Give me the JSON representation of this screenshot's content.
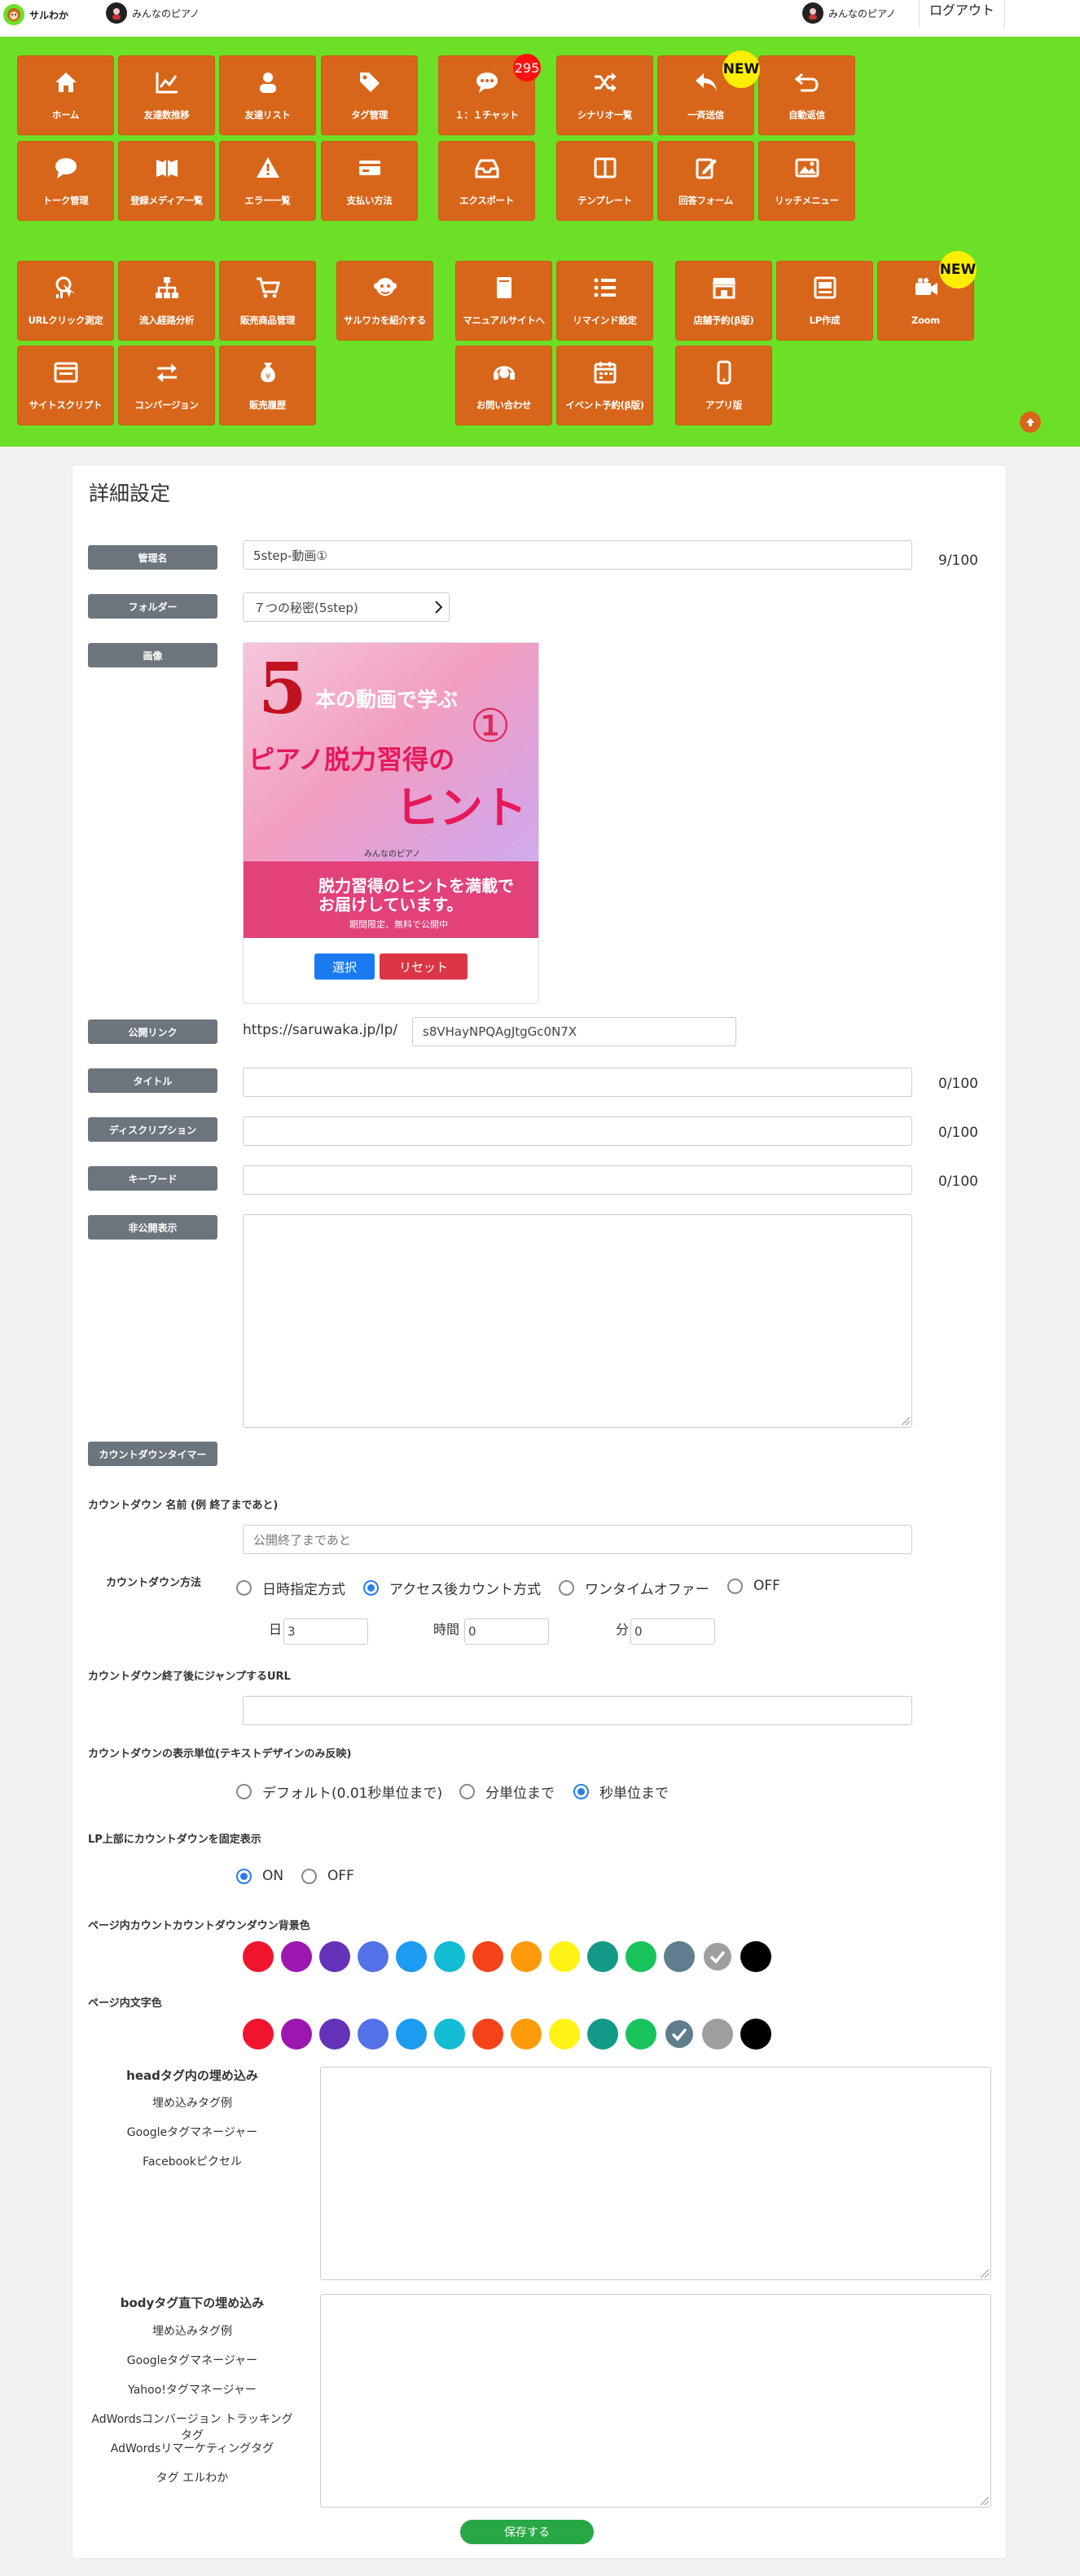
{
  "topbar": {
    "brand": "サルわか",
    "account_left": "みんなのピアノ",
    "account_right": "みんなのピアノ",
    "logout": "ログアウト"
  },
  "nav": {
    "tiles": [
      {
        "label": "ホーム",
        "icon": "home-icon"
      },
      {
        "label": "友達数推移",
        "icon": "line-chart-icon"
      },
      {
        "label": "友達リスト",
        "icon": "user-icon"
      },
      {
        "label": "タグ管理",
        "icon": "tags-icon"
      },
      {
        "label": "１：１チャット",
        "icon": "chat-icon"
      },
      {
        "label": "シナリオ一覧",
        "icon": "shuffle-icon"
      },
      {
        "label": "一斉送信",
        "icon": "reply-icon"
      },
      {
        "label": "自動返信",
        "icon": "return-icon"
      },
      {
        "label": "トーク管理",
        "icon": "speech-bubble-icon"
      },
      {
        "label": "登録メディア一覧",
        "icon": "media-icon"
      },
      {
        "label": "エラー一覧",
        "icon": "warning-icon"
      },
      {
        "label": "支払い方法",
        "icon": "credit-card-icon"
      },
      {
        "label": "エクスポート",
        "icon": "inbox-icon"
      },
      {
        "label": "テンプレート",
        "icon": "columns-icon"
      },
      {
        "label": "回答フォーム",
        "icon": "form-edit-icon"
      },
      {
        "label": "リッチメニュー",
        "icon": "image-icon"
      },
      {
        "label": "URLクリック測定",
        "icon": "click-measure-icon"
      },
      {
        "label": "流入経路分析",
        "icon": "sitemap-icon"
      },
      {
        "label": "販売商品管理",
        "icon": "cart-icon"
      },
      {
        "label": "サルワカを紹介する",
        "icon": "monkey-icon"
      },
      {
        "label": "マニュアルサイトへ",
        "icon": "book-icon"
      },
      {
        "label": "リマインド設定",
        "icon": "list-icon"
      },
      {
        "label": "店舗予約(β版)",
        "icon": "store-icon"
      },
      {
        "label": "LP作成",
        "icon": "lp-icon"
      },
      {
        "label": "Zoom",
        "icon": "video-icon"
      },
      {
        "label": "サイトスクリプト",
        "icon": "browser-icon"
      },
      {
        "label": "コンバージョン",
        "icon": "exchange-icon"
      },
      {
        "label": "販売履歴",
        "icon": "money-bag-icon"
      },
      {
        "label": "お問い合わせ",
        "icon": "headset-icon"
      },
      {
        "label": "イベント予約(β版)",
        "icon": "calendar-icon"
      },
      {
        "label": "アプリ版",
        "icon": "mobile-icon"
      }
    ],
    "chat_count": "295",
    "new_badge": "NEW"
  },
  "form": {
    "heading": "詳細設定",
    "mgmt_label": "管理名",
    "mgmt_value": "5step-動画①",
    "mgmt_count": "9/100",
    "folder_label": "フォルダー",
    "folder_value": "７つの秘密(5step)",
    "image_label": "画像",
    "image": {
      "line1": "本の動画で学ぶ",
      "num5": "5",
      "circled": "①",
      "line2": "ピアノ脱力習得の",
      "line3": "ヒント",
      "brand": "みんなのピアノ",
      "bottom1": "脱力習得のヒントを満載で",
      "bottom2": "お届けしています。",
      "bottom3": "期間限定、無料で公開中"
    },
    "select_btn": "選択",
    "reset_btn": "リセット",
    "publink_label": "公開リンク",
    "publink_prefix": "https://saruwaka.jp/lp/",
    "publink_slug": "s8VHayNPQAgJtgGc0N7X",
    "title_label": "タイトル",
    "title_count": "0/100",
    "desc_label": "ディスクリプション",
    "desc_count": "0/100",
    "kw_label": "キーワード",
    "kw_count": "0/100",
    "private_label": "非公開表示",
    "countdown_btn": "カウントダウンタイマー",
    "cd_name_label": "カウントダウン 名前 (例 終了まであと)",
    "cd_name_placeholder": "公開終了まであと",
    "cd_method_label": "カウントダウン方法",
    "cd_methods": [
      "日時指定方式",
      "アクセス後カウント方式",
      "ワンタイムオファー",
      "OFF"
    ],
    "day_label": "日",
    "day_value": "3",
    "hour_label": "時間",
    "hour_value": "0",
    "min_label": "分",
    "min_value": "0",
    "jump_label": "カウントダウン終了後にジャンプするURL",
    "unit_label": "カウントダウンの表示単位(テキストデザインのみ反映)",
    "units": [
      "デフォルト(0.01秒単位まで)",
      "分単位まで",
      "秒単位まで"
    ],
    "fix_label": "LP上部にカウントダウンを固定表示",
    "fix_on": "ON",
    "fix_off": "OFF",
    "bg_label": "ページ内カウントカウントダウンダウン背景色",
    "text_label": "ページ内文字色",
    "head_title": "headタグ内の埋め込み",
    "head_links": [
      "埋め込みタグ例",
      "Googleタグマネージャー",
      "Facebookピクセル"
    ],
    "body_title": "bodyタグ直下の埋め込み",
    "body_links": [
      "埋め込みタグ例",
      "Googleタグマネージャー",
      "Yahoo!タグマネージャー",
      "AdWordsコンバージョン トラッキングタグ",
      "AdWordsリマーケティングタグ",
      "タグ エルわか"
    ],
    "save_btn": "保存する"
  },
  "colors": {
    "accent_green": "#6ce026",
    "tile_orange": "#d8661a",
    "palette": [
      "#f0142d",
      "#9c17b0",
      "#6432b8",
      "#5472e8",
      "#1b9cf0",
      "#12bcd4",
      "#f44219",
      "#ff9a0a",
      "#fff215",
      "#129a86",
      "#19c35c",
      "#5f7d8c",
      "#9e9e9e",
      "#000000"
    ]
  }
}
